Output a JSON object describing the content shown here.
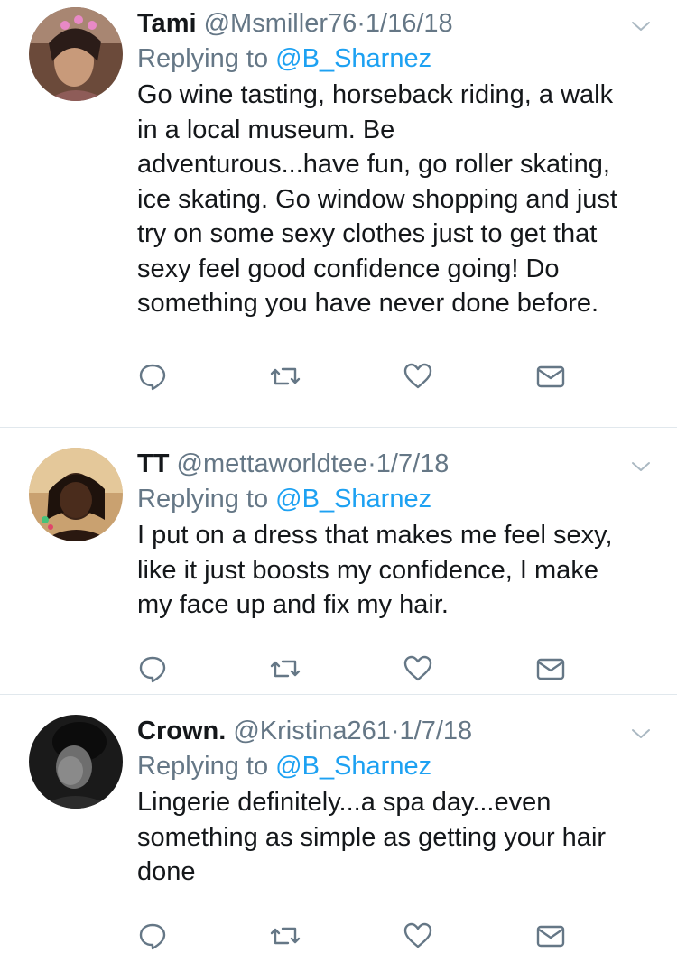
{
  "tweets": [
    {
      "name": "Tami",
      "handle": "@Msmiller76",
      "separator": "·",
      "date": "1/16/18",
      "replying_prefix": "Replying to",
      "replying_to": "@B_Sharnez",
      "text": "Go wine tasting, horseback riding, a walk in a local museum. Be adventurous...have fun, go roller skating, ice skating. Go window shopping and just try on some sexy clothes just to get that sexy feel good confidence going! Do something you have never done before."
    },
    {
      "name": "TT",
      "handle": "@mettaworldtee",
      "separator": "·",
      "date": "1/7/18",
      "replying_prefix": "Replying to",
      "replying_to": "@B_Sharnez",
      "text": "I put on a dress that makes me feel sexy, like it just boosts my confidence, I make my face up and fix my hair."
    },
    {
      "name": "Crown.",
      "handle": "@Kristina261",
      "separator": "·",
      "date": "1/7/18",
      "replying_prefix": "Replying to",
      "replying_to": "@B_Sharnez",
      "text": "Lingerie definitely...a spa day...even something as simple as getting your hair done"
    }
  ],
  "icons": {
    "reply": "reply-icon",
    "retweet": "retweet-icon",
    "like": "heart-icon",
    "dm": "envelope-icon",
    "menu": "chevron-down-icon"
  },
  "colors": {
    "text": "#14171a",
    "secondary": "#657786",
    "link": "#1da1f2",
    "divider": "#e1e8ed"
  }
}
